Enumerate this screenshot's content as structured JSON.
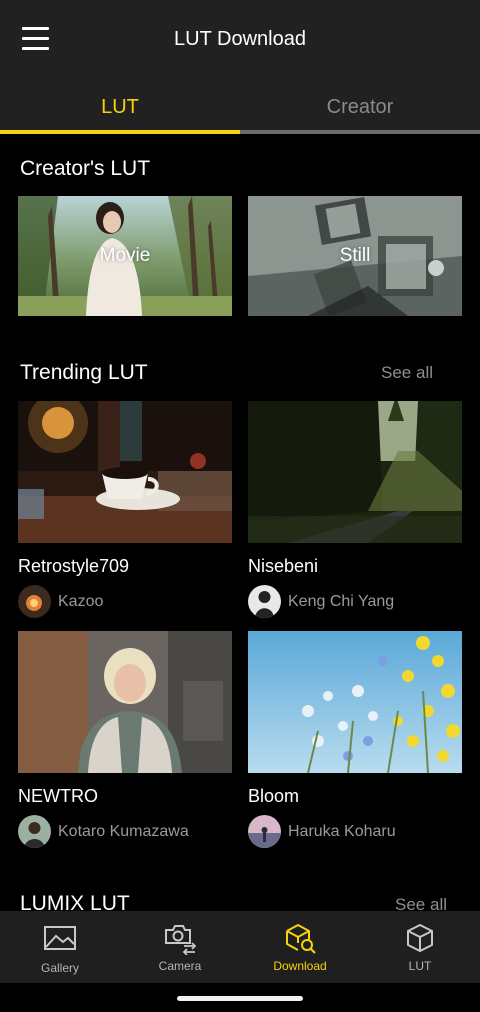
{
  "header": {
    "title": "LUT Download"
  },
  "tabs": [
    {
      "label": "LUT",
      "active": true
    },
    {
      "label": "Creator",
      "active": false
    }
  ],
  "creators_lut": {
    "title": "Creator's LUT",
    "cards": [
      {
        "label": "Movie"
      },
      {
        "label": "Still"
      }
    ]
  },
  "trending": {
    "title": "Trending LUT",
    "see_all": "See all",
    "items": [
      {
        "name": "Retrostyle709",
        "author": "Kazoo"
      },
      {
        "name": "Nisebeni",
        "author": "Keng Chi Yang"
      },
      {
        "name": "NEWTRO",
        "author": "Kotaro Kumazawa"
      },
      {
        "name": "Bloom",
        "author": "Haruka Koharu"
      }
    ]
  },
  "lumix": {
    "title": "LUMIX LUT",
    "see_all": "See all"
  },
  "bottom_nav": [
    {
      "label": "Gallery",
      "icon": "gallery-icon"
    },
    {
      "label": "Camera",
      "icon": "camera-transfer-icon"
    },
    {
      "label": "Download",
      "icon": "download-lut-icon",
      "active": true
    },
    {
      "label": "LUT",
      "icon": "lut-cube-icon"
    }
  ],
  "colors": {
    "accent": "#f5d20a",
    "bar_bg": "#212121",
    "background": "#000000"
  }
}
